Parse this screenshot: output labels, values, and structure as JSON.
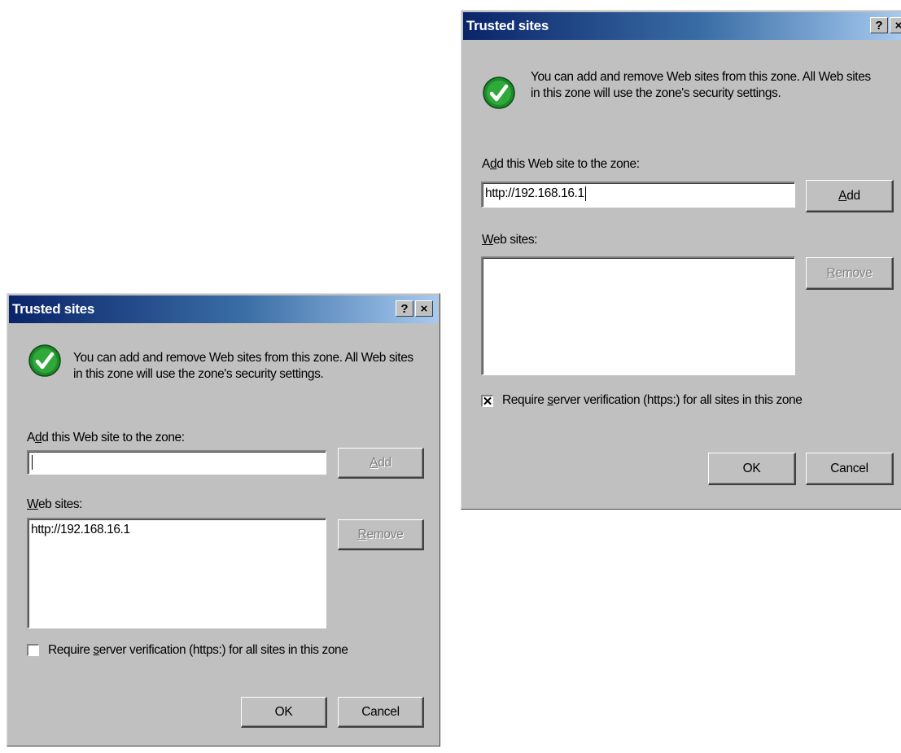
{
  "left_dialog": {
    "title": "Trusted sites",
    "help_glyph": "?",
    "close_glyph": "×",
    "icon": "green-checkmark-icon",
    "intro_line1": "You can add and remove Web sites from this zone. All Web sites",
    "intro_line2": "in this zone will use the zone's security settings.",
    "add_label_pre": "A",
    "add_label_u": "d",
    "add_label_post": "d this Web site to the zone:",
    "add_input_value": "",
    "add_button_u": "A",
    "add_button_rest": "dd",
    "websites_label_u": "W",
    "websites_label_rest": "eb sites:",
    "websites": [
      "http://192.168.16.1"
    ],
    "remove_button_u": "R",
    "remove_button_rest": "emove",
    "require_pre": "Require ",
    "require_u": "s",
    "require_post": "erver verification (https:) for all sites in this zone",
    "require_checked": false,
    "check_glyph": "",
    "ok_label": "OK",
    "cancel_label": "Cancel"
  },
  "right_dialog": {
    "title": "Trusted sites",
    "help_glyph": "?",
    "close_glyph": "×",
    "icon": "green-checkmark-icon",
    "intro_line1": "You can add and remove Web sites from this zone. All Web sites",
    "intro_line2": "in this zone will use the zone's security settings.",
    "add_label_pre": "A",
    "add_label_u": "d",
    "add_label_post": "d this Web site to the zone:",
    "add_input_value": "http://192.168.16.1",
    "add_button_u": "A",
    "add_button_rest": "dd",
    "websites_label_u": "W",
    "websites_label_rest": "eb sites:",
    "websites": [],
    "remove_button_u": "R",
    "remove_button_rest": "emove",
    "require_pre": "Require ",
    "require_u": "s",
    "require_post": "erver verification (https:) for all sites in this zone",
    "require_checked": true,
    "check_glyph": "✕",
    "ok_label": "OK",
    "cancel_label": "Cancel"
  },
  "colors": {
    "dialog_face": "#c0c0c0",
    "titlebar_start": "#0a246a",
    "titlebar_end": "#a6caf0",
    "check_green": "#1e8a2a"
  }
}
